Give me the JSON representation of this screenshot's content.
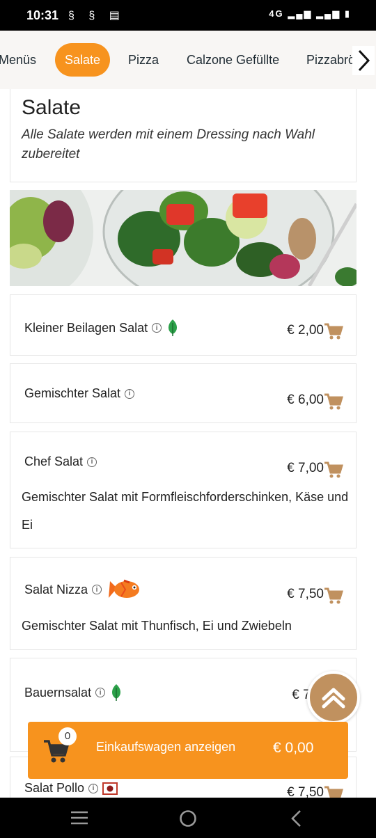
{
  "status_bar": {
    "time": "10:31",
    "left_icons": [
      "notification-icon",
      "notification-icon",
      "message-icon"
    ],
    "network": "4G"
  },
  "tabs": [
    {
      "label": "Menüs",
      "active": false
    },
    {
      "label": "Salate",
      "active": true
    },
    {
      "label": "Pizza",
      "active": false
    },
    {
      "label": "Calzone Gefüllte",
      "active": false
    },
    {
      "label": "Pizzabrö",
      "active": false
    }
  ],
  "section": {
    "title": "Salate",
    "subtitle": "Alle Salate werden mit einem Dressing nach Wahl zubereitet"
  },
  "items": [
    {
      "name": "Kleiner Beilagen Salat",
      "badge": "vegetarian-leaf-icon",
      "price": "€ 2,00",
      "description": ""
    },
    {
      "name": "Gemischter Salat",
      "badge": "",
      "price": "€ 6,00",
      "description": ""
    },
    {
      "name": "Chef Salat",
      "badge": "",
      "price": "€ 7,00",
      "description": "Gemischter Salat mit Formfleischforderschinken, Käse und Ei"
    },
    {
      "name": "Salat Nizza",
      "badge": "fish-icon",
      "price": "€ 7,50",
      "description": "Gemischter Salat mit Thunfisch, Ei und Zwiebeln"
    },
    {
      "name": "Bauernsalat",
      "badge": "vegetarian-leaf-icon",
      "price": "€ 7,",
      "description": ""
    },
    {
      "name": "Salat Pollo",
      "badge": "chicken-icon",
      "price": "€ 7,50",
      "description": ""
    }
  ],
  "cart": {
    "count": "0",
    "label": "Einkaufswagen anzeigen",
    "total": "€ 0,00"
  },
  "colors": {
    "accent": "#f7931e",
    "cart_icon": "#c0915f"
  }
}
